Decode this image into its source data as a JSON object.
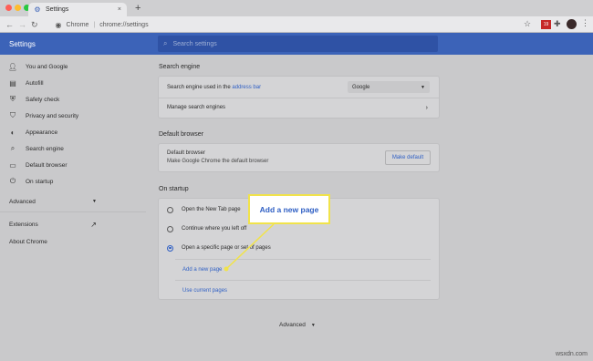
{
  "window": {
    "traffic_colors": {
      "close": "#ff5f57",
      "minimize": "#febc2e",
      "zoom": "#28c840"
    },
    "tab_title": "Settings",
    "tab_close": "×",
    "new_tab": "+"
  },
  "toolbar": {
    "origin_label": "Chrome",
    "url": "chrome://settings",
    "extensions_badge": "19"
  },
  "header": {
    "title": "Settings",
    "search_placeholder": "Search settings"
  },
  "sidebar": {
    "items": [
      {
        "label": "You and Google",
        "icon": "person-icon"
      },
      {
        "label": "Autofill",
        "icon": "clipboard-icon"
      },
      {
        "label": "Safety check",
        "icon": "shield-check-icon"
      },
      {
        "label": "Privacy and security",
        "icon": "shield-icon"
      },
      {
        "label": "Appearance",
        "icon": "palette-icon"
      },
      {
        "label": "Search engine",
        "icon": "search-icon"
      },
      {
        "label": "Default browser",
        "icon": "browser-icon"
      },
      {
        "label": "On startup",
        "icon": "power-icon"
      }
    ],
    "advanced": "Advanced",
    "extensions": "Extensions",
    "about": "About Chrome"
  },
  "search_engine": {
    "section_title": "Search engine",
    "row1_prefix": "Search engine used in the ",
    "row1_link": "address bar",
    "selected": "Google",
    "row2": "Manage search engines"
  },
  "default_browser": {
    "section_title": "Default browser",
    "title": "Default browser",
    "subtitle": "Make Google Chrome the default browser",
    "button": "Make default"
  },
  "on_startup": {
    "section_title": "On startup",
    "options": [
      {
        "label": "Open the New Tab page",
        "selected": false
      },
      {
        "label": "Continue where you left off",
        "selected": false
      },
      {
        "label": "Open a specific page or set of pages",
        "selected": true
      }
    ],
    "add_page": "Add a new page",
    "use_current": "Use current pages"
  },
  "footer_advanced": "Advanced",
  "callout": {
    "text": "Add a new page",
    "border_color": "#f1e34a"
  },
  "watermark": "wsxdn.com"
}
